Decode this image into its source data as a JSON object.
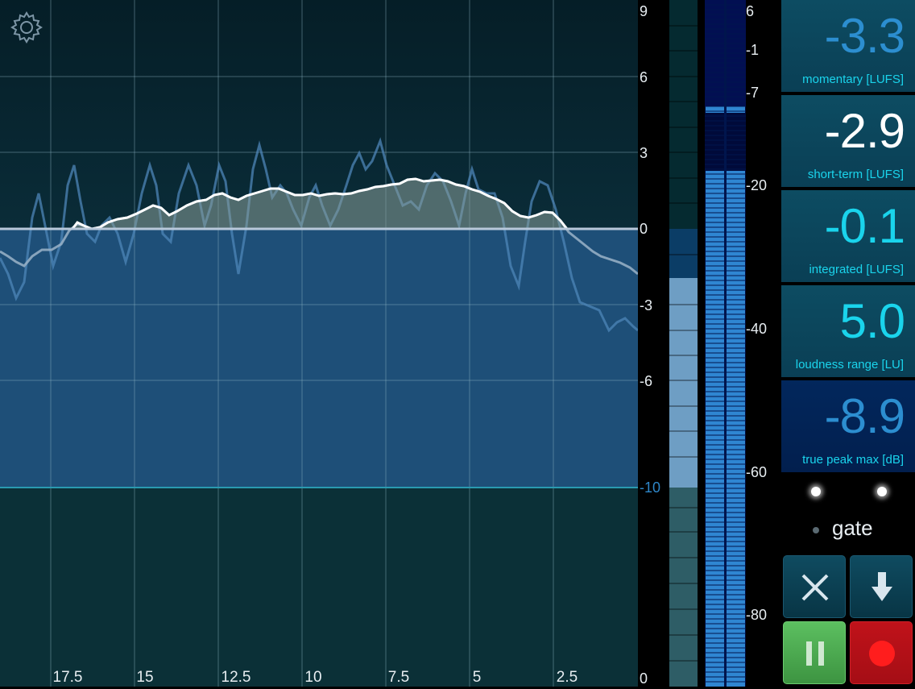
{
  "graph": {
    "y_ticks": [
      "9",
      "6",
      "3",
      "0",
      "-3",
      "-6",
      "-10",
      "0"
    ],
    "x_ticks": [
      "17.5",
      "15",
      "12.5",
      "10",
      "7.5",
      "5",
      "2.5"
    ]
  },
  "meter": {
    "ticks": [
      "6",
      "-1",
      "-7",
      "-20",
      "-40",
      "-60",
      "-80"
    ]
  },
  "readouts": [
    {
      "value": "-3.3",
      "label": "momentary [LUFS]"
    },
    {
      "value": "-2.9",
      "label": "short-term [LUFS]"
    },
    {
      "value": "-0.1",
      "label": "integrated [LUFS]"
    },
    {
      "value": "5.0",
      "label": "loudness range [LU]"
    },
    {
      "value": "-8.9",
      "label": "true peak max [dB]"
    }
  ],
  "gate": {
    "label": "gate"
  },
  "icons": {
    "settings": "gear-icon",
    "reset": "close-icon",
    "export": "arrow-down-icon",
    "pause": "pause-icon",
    "record": "record-icon"
  },
  "colors": {
    "accent_cyan": "#1ad4ec",
    "accent_blue": "#2e86c8",
    "record_red": "#c0121a",
    "pause_green": "#4ba84e"
  }
}
